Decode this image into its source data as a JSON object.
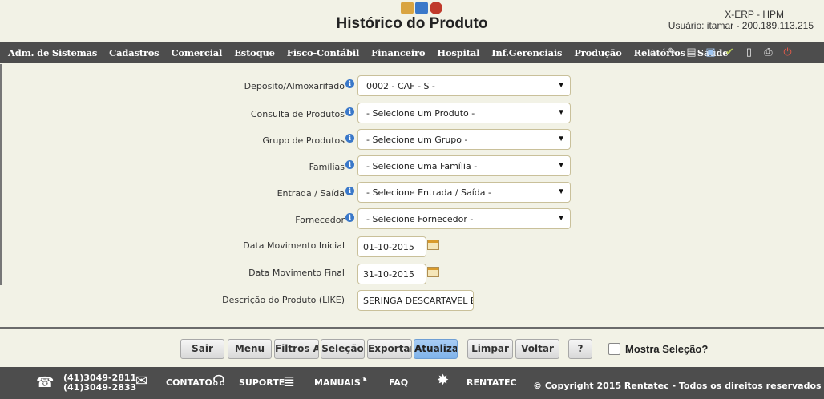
{
  "header": {
    "title": "Histórico do Produto",
    "system": "X-ERP - HPM",
    "user": "Usuário: itamar - 200.189.113.215"
  },
  "menu": [
    "Adm. de Sistemas",
    "Cadastros",
    "Comercial",
    "Estoque",
    "Fisco-Contábil",
    "Financeiro",
    "Hospital",
    "Inf.Gerenciais",
    "Produção",
    "Relatórios",
    "Saúde"
  ],
  "toolbar_icons": [
    "home-icon",
    "edit-icon",
    "document-icon",
    "save-icon",
    "check-icon",
    "file-icon",
    "print-icon",
    "exit-icon"
  ],
  "form": {
    "deposito": {
      "label": "Deposito/Almoxarifado",
      "value": "0002 - CAF - S -"
    },
    "produto": {
      "label": "Consulta de Produtos",
      "value": "- Selecione um Produto -"
    },
    "grupo": {
      "label": "Grupo de Produtos",
      "value": "- Selecione um Grupo -"
    },
    "familia": {
      "label": "Famílias",
      "value": "- Selecione uma Família -"
    },
    "entrada": {
      "label": "Entrada / Saída",
      "value": "- Selecione Entrada / Saída -"
    },
    "fornecedor": {
      "label": "Fornecedor",
      "value": "- Selecione Fornecedor -"
    },
    "data_inicial": {
      "label": "Data Movimento Inicial",
      "value": "01-10-2015"
    },
    "data_final": {
      "label": "Data Movimento Final",
      "value": "31-10-2015"
    },
    "descricao": {
      "label": "Descrição do Produto (LIKE)",
      "value": "SERINGA DESCARTAVEL BIC"
    }
  },
  "buttons": {
    "sair": "Sair",
    "menu": "Menu",
    "filtros": "Filtros Av",
    "selecao": "Seleção",
    "exportar": "Exportar",
    "atualizar": "Atualizar",
    "limpar": "Limpar",
    "voltar": "Voltar",
    "help": "?"
  },
  "mostra_selecao": "Mostra Seleção?",
  "footer": {
    "phone1": "(41)3049-2811",
    "phone2": "(41)3049-2833",
    "contato": "CONTATO",
    "suporte": "SUPORTE",
    "manuais": "MANUAIS",
    "faq": "FAQ",
    "rentatec": "RENTATEC",
    "copyright": "© Copyright 2015 Rentatec - Todos os direitos reservados"
  },
  "colors": {
    "menubar": "#4d4d4d",
    "background": "#f2f2e6",
    "active_button": "#8fbef0"
  }
}
